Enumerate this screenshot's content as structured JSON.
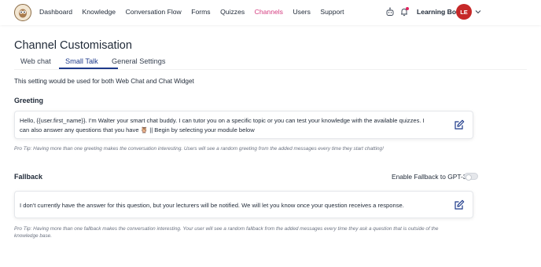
{
  "nav": {
    "items": [
      "Dashboard",
      "Knowledge",
      "Conversation Flow",
      "Forms",
      "Quizzes",
      "Channels",
      "Users",
      "Support"
    ],
    "active": "Channels",
    "bot_name": "Learning Bot",
    "avatar_initials": "LE"
  },
  "page": {
    "title": "Channel Customisation",
    "tabs": [
      "Web chat",
      "Small Talk",
      "General Settings"
    ],
    "active_tab": "Small Talk",
    "note": "This setting would be used for both Web Chat and Chat Widget"
  },
  "greeting": {
    "title": "Greeting",
    "message_line1": "Hello, {{user.first_name}}. I'm Walter your smart chat buddy. I can tutor you on a specific topic or you can test your knowledge with the available quizzes. I",
    "message_line2": "can also answer any questions that you have 🦉 || Begin by selecting your module below",
    "tip": "Pro Tip: Having more than one greeting makes the conversation interesting. Users will see a random greeting from the added messages every time they start chatting!"
  },
  "fallback": {
    "title": "Fallback",
    "gpt_toggle_label": "Enable Fallback to GPT-3",
    "gpt_enabled": false,
    "message": "I don't currently have the answer for this question, but your lecturers will be notified. We will let you know once your question receives a response.",
    "tip": "Pro Tip: Having more than one fallback makes the conversation interesting. Your user will see a random fallback from the added messages every time they ask a question that is outside of the knowledge base."
  },
  "colors": {
    "accent": "#d43b7f",
    "tab_active": "#1e3a8a",
    "edit_icon": "#1e3a8a",
    "avatar": "#c62828"
  }
}
